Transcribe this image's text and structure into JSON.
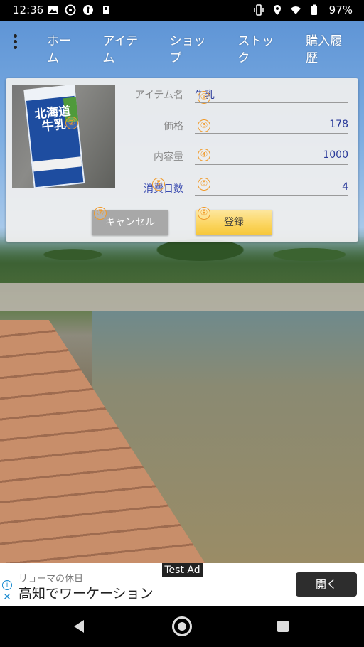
{
  "status_bar": {
    "time": "12:36",
    "battery": "97%"
  },
  "nav": {
    "tabs": [
      "ホーム",
      "アイテム",
      "ショップ",
      "ストック",
      "購入履歴"
    ]
  },
  "form": {
    "item_name_label": "アイテム名",
    "item_name_value": "牛乳",
    "price_label": "価格",
    "price_value": "178",
    "capacity_label": "内容量",
    "capacity_value": "1000",
    "consumption_days_label": "消費日数",
    "consumption_days_value": "4",
    "cancel_label": "キャンセル",
    "register_label": "登録",
    "badges": [
      "①",
      "②",
      "③",
      "④",
      "⑤",
      "⑥",
      "⑦",
      "⑧"
    ]
  },
  "photo": {
    "package_text": "北海道牛乳"
  },
  "ad": {
    "tag": "Test Ad",
    "source": "リョーマの休日",
    "headline": "高知でワーケーション",
    "open_label": "開く",
    "info_symbol": "i",
    "close_symbol": "✕"
  }
}
